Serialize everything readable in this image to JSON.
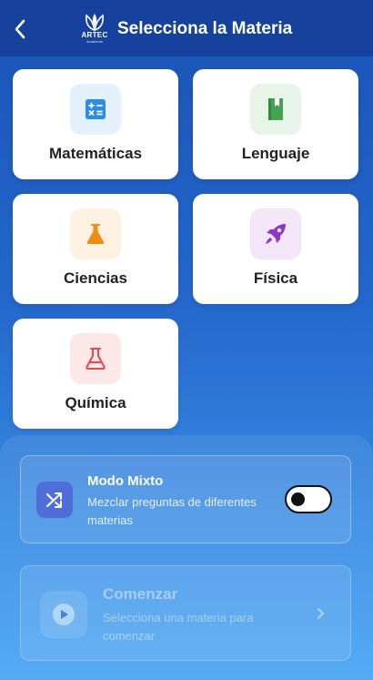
{
  "header": {
    "title": "Selecciona la Materia",
    "logo_text": "ARTEC",
    "logo_sub": "Academia"
  },
  "subjects": [
    {
      "label": "Matemáticas",
      "icon": "calculator-icon",
      "bg": "#e3f1fd",
      "color": "#2b8de6"
    },
    {
      "label": "Lenguaje",
      "icon": "book-icon",
      "bg": "#e6f5e8",
      "color": "#43a350"
    },
    {
      "label": "Ciencias",
      "icon": "flask-icon",
      "bg": "#fdf1e1",
      "color": "#ef8c14"
    },
    {
      "label": "Física",
      "icon": "rocket-icon",
      "bg": "#f3e6f8",
      "color": "#8e35c2"
    },
    {
      "label": "Química",
      "icon": "beaker-icon",
      "bg": "#fde8e8",
      "color": "#e5484d"
    }
  ],
  "mixed_mode": {
    "title": "Modo Mixto",
    "description": "Mezclar preguntas de diferentes materias",
    "icon": "shuffle-icon",
    "enabled": false
  },
  "start": {
    "title": "Comenzar",
    "description": "Selecciona una materia para comenzar",
    "icon": "play-icon"
  }
}
